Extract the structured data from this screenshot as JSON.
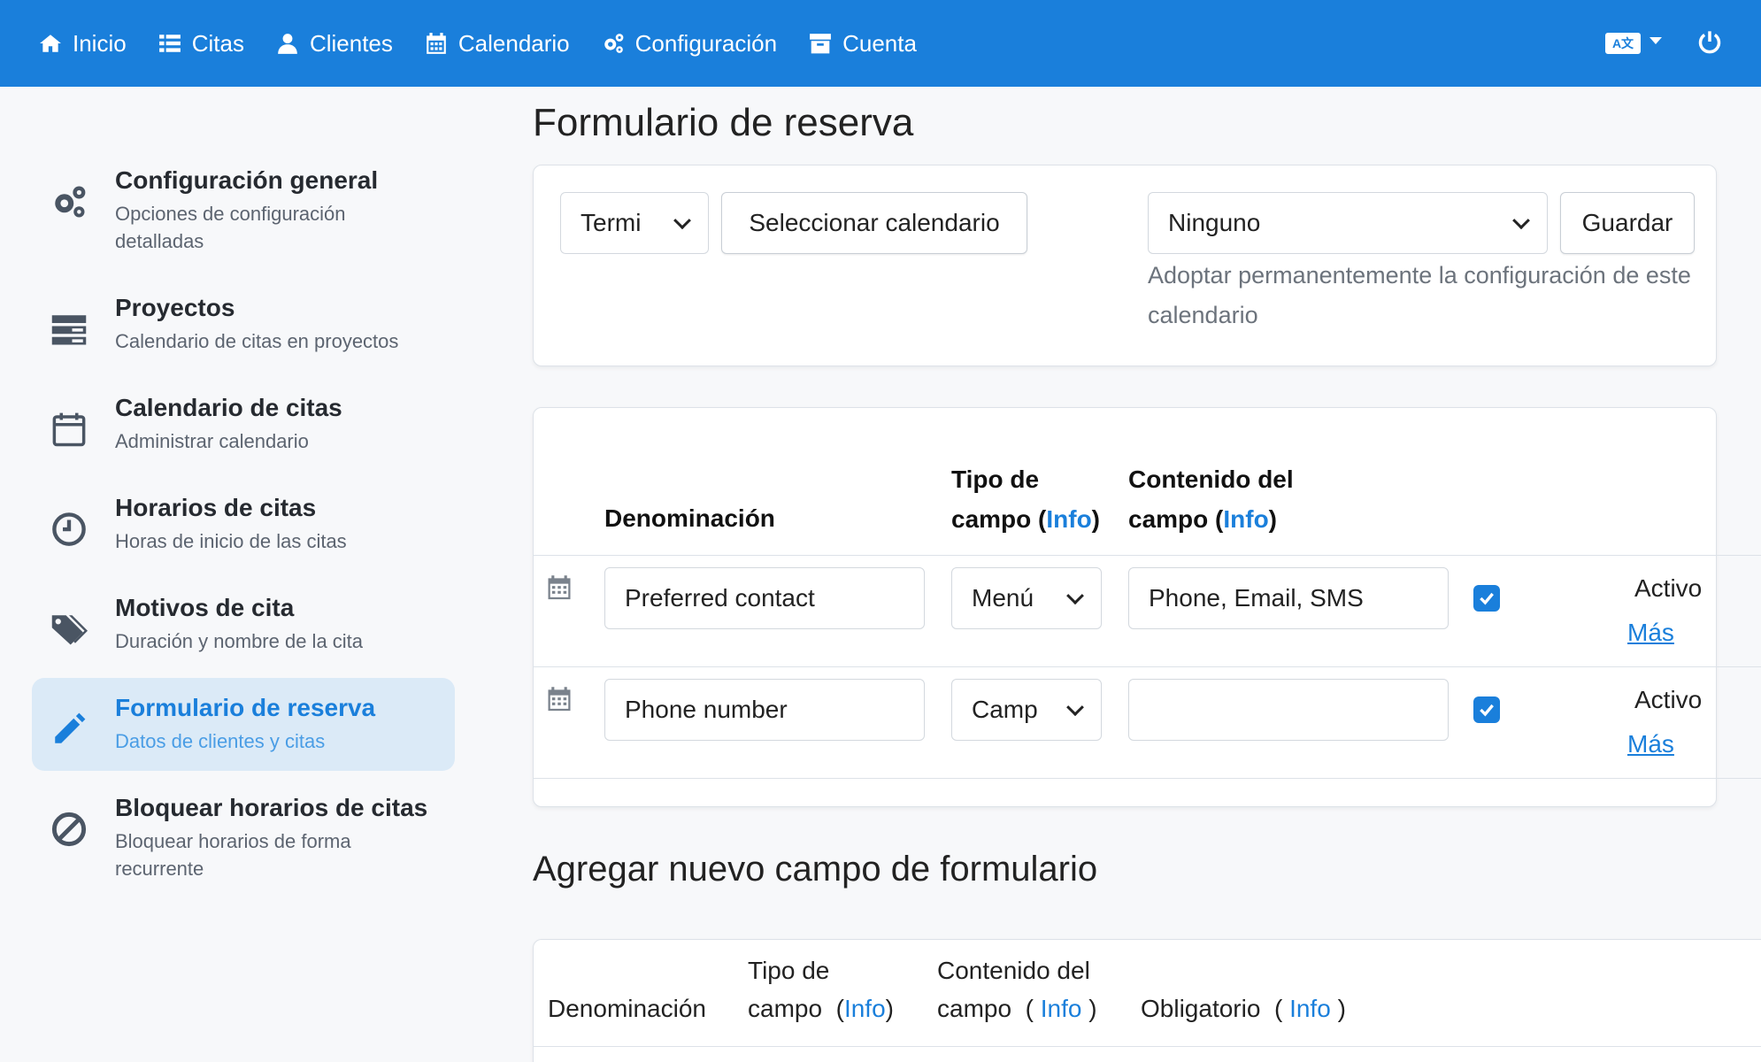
{
  "nav": {
    "items": [
      {
        "label": "Inicio",
        "icon": "home-icon"
      },
      {
        "label": "Citas",
        "icon": "list-icon"
      },
      {
        "label": "Clientes",
        "icon": "user-icon"
      },
      {
        "label": "Calendario",
        "icon": "calendar-icon"
      },
      {
        "label": "Configuración",
        "icon": "gears-icon"
      },
      {
        "label": "Cuenta",
        "icon": "archive-icon"
      }
    ],
    "language_icon_text": "A文",
    "accent_color": "#1a7fdb"
  },
  "sidebar": {
    "items": [
      {
        "title": "Configuración general",
        "subtitle": "Opciones de configuración detalladas",
        "icon": "gears-icon"
      },
      {
        "title": "Proyectos",
        "subtitle": "Calendario de citas en proyectos",
        "icon": "server-icon"
      },
      {
        "title": "Calendario de citas",
        "subtitle": "Administrar calendario",
        "icon": "calendar-icon"
      },
      {
        "title": "Horarios de citas",
        "subtitle": "Horas de inicio de las citas",
        "icon": "clock-icon"
      },
      {
        "title": "Motivos de cita",
        "subtitle": "Duración y nombre de la cita",
        "icon": "tags-icon"
      },
      {
        "title": "Formulario de reserva",
        "subtitle": "Datos de clientes y citas",
        "icon": "pencil-icon",
        "active": true
      },
      {
        "title": "Bloquear horarios de citas",
        "subtitle": "Bloquear horarios de forma recurrente",
        "icon": "ban-icon"
      }
    ]
  },
  "main": {
    "title": "Formulario de reserva",
    "toolbar": {
      "type_select": "Termi",
      "select_calendar_label": "Seleccionar calendario",
      "calendar_select": "Ninguno",
      "save_label": "Guardar",
      "help_text": "Adoptar permanentemente la configuración de este calendario"
    },
    "fields_table": {
      "headers": {
        "name": "Denominación",
        "type_line1": "Tipo de",
        "type_line2": "campo (",
        "content_line1": "Contenido del",
        "content_line2": "campo (",
        "info": "Info",
        "close": ")"
      },
      "rows": [
        {
          "name": "Preferred contact",
          "type": "Menú",
          "content": "Phone, Email, SMS",
          "checked": true,
          "status": "Activo",
          "more": "Más"
        },
        {
          "name": "Phone number",
          "type": "Camp",
          "content": "",
          "checked": true,
          "status": "Activo",
          "more": "Más"
        }
      ]
    },
    "new_field": {
      "title": "Agregar nuevo campo de formulario",
      "headers": {
        "name": "Denominación",
        "type_line1": "Tipo de",
        "type_line2": "campo",
        "content_line1": "Contenido del",
        "content_line2": "campo",
        "required": "Obligatorio",
        "info": "Info",
        "open": "(",
        "close": ")"
      }
    }
  }
}
